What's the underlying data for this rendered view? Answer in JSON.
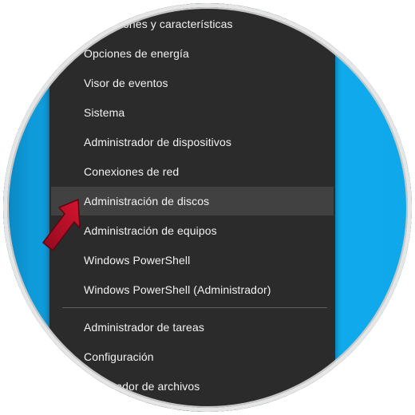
{
  "menu": {
    "items": [
      {
        "label": "Aplicaciones y características"
      },
      {
        "label": "Opciones de energía"
      },
      {
        "label": "Visor de eventos"
      },
      {
        "label": "Sistema"
      },
      {
        "label": "Administrador de dispositivos"
      },
      {
        "label": "Conexiones de red"
      },
      {
        "label": "Administración de discos",
        "highlighted": true
      },
      {
        "label": "Administración de equipos"
      },
      {
        "label": "Windows PowerShell"
      },
      {
        "label": "Windows PowerShell (Administrador)"
      },
      {
        "label": "Administrador de tareas"
      },
      {
        "label": "Configuración"
      },
      {
        "label": "Explorador de archivos"
      }
    ]
  },
  "colors": {
    "menu_background": "#2b2b2b",
    "menu_hover": "#414141",
    "desktop_accent": "#12aef0",
    "pointer_arrow": "#c8102e"
  },
  "icons": {
    "pointer": "red-arrow-icon"
  }
}
